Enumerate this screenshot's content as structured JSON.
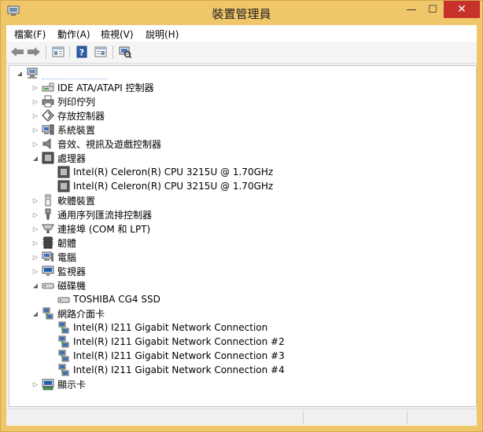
{
  "window": {
    "title": "裝置管理員",
    "min_glyph": "—",
    "max_glyph": "☐",
    "close_glyph": "✕"
  },
  "menu": [
    {
      "label": "檔案(F)"
    },
    {
      "label": "動作(A)"
    },
    {
      "label": "檢視(V)"
    },
    {
      "label": "說明(H)"
    }
  ],
  "toolbar": [
    "back-icon",
    "forward-icon",
    "properties-icon",
    "help-icon",
    "view-icon",
    "scan-hardware-icon"
  ],
  "tree": [
    {
      "label": "",
      "level": 0,
      "state": "expanded",
      "icon": "computer-icon"
    },
    {
      "label": "IDE ATA/ATAPI 控制器",
      "level": 1,
      "state": "collapsed",
      "icon": "ide-controller-icon"
    },
    {
      "label": "列印佇列",
      "level": 1,
      "state": "collapsed",
      "icon": "printer-icon"
    },
    {
      "label": "存放控制器",
      "level": 1,
      "state": "collapsed",
      "icon": "storage-controller-icon"
    },
    {
      "label": "系統裝置",
      "level": 1,
      "state": "collapsed",
      "icon": "system-device-icon"
    },
    {
      "label": "音效、視訊及遊戲控制器",
      "level": 1,
      "state": "collapsed",
      "icon": "speaker-icon"
    },
    {
      "label": "處理器",
      "level": 1,
      "state": "expanded",
      "icon": "processor-icon"
    },
    {
      "label": "Intel(R) Celeron(R) CPU 3215U @ 1.70GHz",
      "level": 2,
      "state": "leaf",
      "icon": "processor-icon"
    },
    {
      "label": "Intel(R) Celeron(R) CPU 3215U @ 1.70GHz",
      "level": 2,
      "state": "leaf",
      "icon": "processor-icon"
    },
    {
      "label": "軟體裝置",
      "level": 1,
      "state": "collapsed",
      "icon": "software-device-icon"
    },
    {
      "label": "通用序列匯流排控制器",
      "level": 1,
      "state": "collapsed",
      "icon": "usb-icon"
    },
    {
      "label": "連接埠 (COM 和 LPT)",
      "level": 1,
      "state": "collapsed",
      "icon": "port-icon"
    },
    {
      "label": "韌體",
      "level": 1,
      "state": "collapsed",
      "icon": "firmware-icon"
    },
    {
      "label": "電腦",
      "level": 1,
      "state": "collapsed",
      "icon": "computer-icon"
    },
    {
      "label": "監視器",
      "level": 1,
      "state": "collapsed",
      "icon": "monitor-icon"
    },
    {
      "label": "磁碟機",
      "level": 1,
      "state": "expanded",
      "icon": "disk-drive-icon"
    },
    {
      "label": "TOSHIBA CG4 SSD",
      "level": 2,
      "state": "leaf",
      "icon": "disk-drive-icon"
    },
    {
      "label": "網路介面卡",
      "level": 1,
      "state": "expanded",
      "icon": "network-adapter-icon"
    },
    {
      "label": "Intel(R) I211 Gigabit Network Connection",
      "level": 2,
      "state": "leaf",
      "icon": "network-adapter-icon"
    },
    {
      "label": "Intel(R) I211 Gigabit Network Connection #2",
      "level": 2,
      "state": "leaf",
      "icon": "network-adapter-icon"
    },
    {
      "label": "Intel(R) I211 Gigabit Network Connection #3",
      "level": 2,
      "state": "leaf",
      "icon": "network-adapter-icon"
    },
    {
      "label": "Intel(R) I211 Gigabit Network Connection #4",
      "level": 2,
      "state": "leaf",
      "icon": "network-adapter-icon"
    },
    {
      "label": "顯示卡",
      "level": 1,
      "state": "collapsed",
      "icon": "display-adapter-icon"
    }
  ],
  "colors": {
    "window_frame": "#f0c66a",
    "close_button": "#c7312b",
    "tree_background": "#ffffff"
  }
}
